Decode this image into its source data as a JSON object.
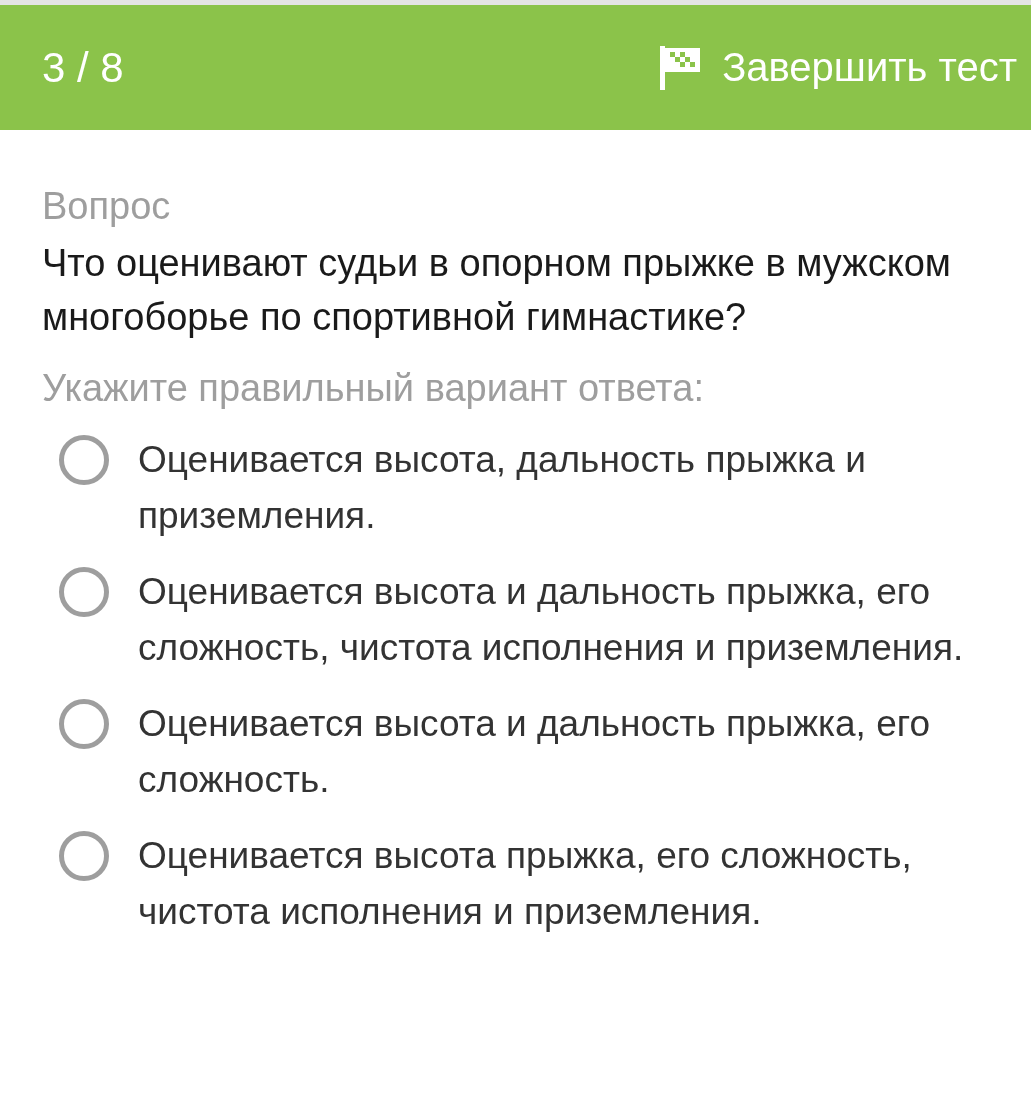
{
  "header": {
    "progress": "3 / 8",
    "finish_button": {
      "label": "Завершить тест"
    }
  },
  "question": {
    "label": "Вопрос",
    "text": "Что оценивают судьи в опорном прыжке в мужском многоборье по спортивной гимнастике?",
    "instruction": "Укажите правильный вариант ответа:"
  },
  "options": [
    {
      "text": "Оценивается высота, дальность прыжка и приземления.",
      "selected": false
    },
    {
      "text": "Оценивается высота и дальность прыжка, его сложность, чистота исполнения и приземления.",
      "selected": false
    },
    {
      "text": "Оценивается высота и дальность прыжка, его сложность.",
      "selected": false
    },
    {
      "text": "Оценивается высота прыжка, его сложность, чистота исполнения и приземления.",
      "selected": false
    }
  ]
}
